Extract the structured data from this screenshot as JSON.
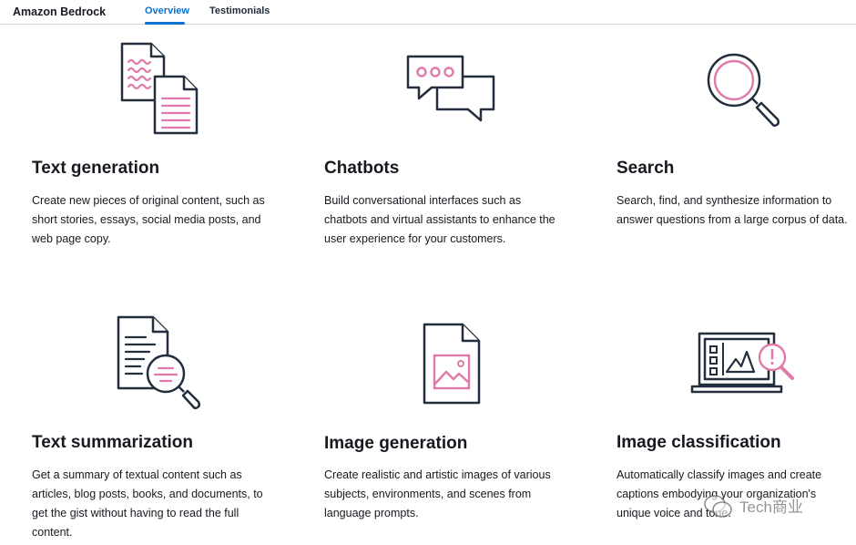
{
  "header": {
    "brand": "Amazon Bedrock",
    "tabs": [
      {
        "label": "Overview",
        "active": true
      },
      {
        "label": "Testimonials",
        "active": false
      }
    ]
  },
  "colors": {
    "accent": "#0972d3",
    "illustration_pink": "#e07aa8",
    "illustration_stroke": "#232f3e"
  },
  "cards": [
    {
      "title": "Text generation",
      "icon": "documents-icon",
      "lines": [
        "Create new pieces of original content, such as",
        "short stories, essays, social media posts, and",
        "web page copy."
      ]
    },
    {
      "title": "Chatbots",
      "icon": "chat-bubbles-icon",
      "lines": [
        "Build conversational interfaces such as",
        "chatbots and virtual assistants to enhance the",
        "user experience for your customers."
      ]
    },
    {
      "title": "Search",
      "icon": "magnifier-icon",
      "lines": [
        "Search, find, and synthesize information to",
        "answer questions from a large corpus of data."
      ]
    },
    {
      "title": "Text summarization",
      "icon": "document-search-icon",
      "lines": [
        "Get a summary of textual content such as",
        "articles, blog posts, books, and documents, to",
        "get the gist without having to read the full",
        "content."
      ]
    },
    {
      "title": "Image generation",
      "icon": "image-file-icon",
      "lines": [
        "Create realistic and artistic images of various",
        "subjects, environments, and scenes from",
        "language prompts."
      ]
    },
    {
      "title": "Image classification",
      "icon": "laptop-chart-icon",
      "lines": [
        "Automatically classify images and create",
        "captions embodying your organization's",
        "unique voice and tone."
      ]
    }
  ],
  "watermark": {
    "text": "Tech商业",
    "icon": "wechat-icon"
  }
}
